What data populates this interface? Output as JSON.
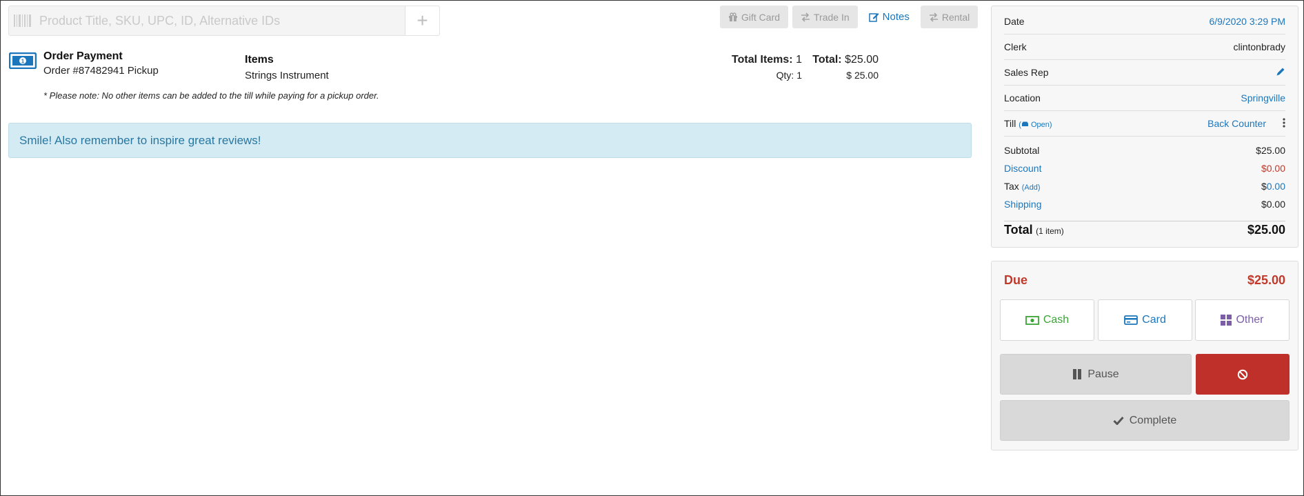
{
  "search": {
    "placeholder": "Product Title, SKU, UPC, ID, Alternative IDs",
    "barcode_icon": "barcode-icon",
    "add_icon": "plus-icon"
  },
  "actions": {
    "gift_card": "Gift Card",
    "trade_in": "Trade In",
    "notes": "Notes",
    "rental": "Rental"
  },
  "order": {
    "icon": "money-bill-icon",
    "title": "Order Payment",
    "subtitle": "Order #87482941 Pickup",
    "items_heading": "Items",
    "item_name": "Strings Instrument",
    "note": "* Please note: No other items can be added to the till while paying for a pickup order.",
    "total_items_label": "Total Items:",
    "total_items_value": "1",
    "total_label": "Total:",
    "total_value": "$25.00",
    "qty_label": "Qty: 1",
    "qty_amount": "$ 25.00"
  },
  "banner": {
    "text": "Smile! Also remember to inspire great reviews!"
  },
  "summary": {
    "date_label": "Date",
    "date_value": "6/9/2020 3:29 PM",
    "clerk_label": "Clerk",
    "clerk_value": "clintonbrady",
    "sales_rep_label": "Sales Rep",
    "location_label": "Location",
    "location_value": "Springville",
    "till_label": "Till",
    "till_status": "Open",
    "till_value": "Back Counter",
    "subtotal_label": "Subtotal",
    "subtotal_value": "$25.00",
    "discount_label": "Discount",
    "discount_value": "$0.00",
    "tax_label": "Tax",
    "tax_add": "(Add)",
    "tax_currency": "$",
    "tax_value": "0.00",
    "shipping_label": "Shipping",
    "shipping_value": "$0.00",
    "total_label": "Total",
    "total_count": "(1 item)",
    "total_value": "$25.00"
  },
  "payment": {
    "due_label": "Due",
    "due_value": "$25.00",
    "cash": "Cash",
    "card": "Card",
    "other": "Other",
    "pause": "Pause",
    "complete": "Complete"
  },
  "colors": {
    "link": "#1b76bb",
    "danger": "#c0392b",
    "cash": "#3aa435",
    "other": "#7b5ea7",
    "banner_bg": "#d4ebf4"
  }
}
